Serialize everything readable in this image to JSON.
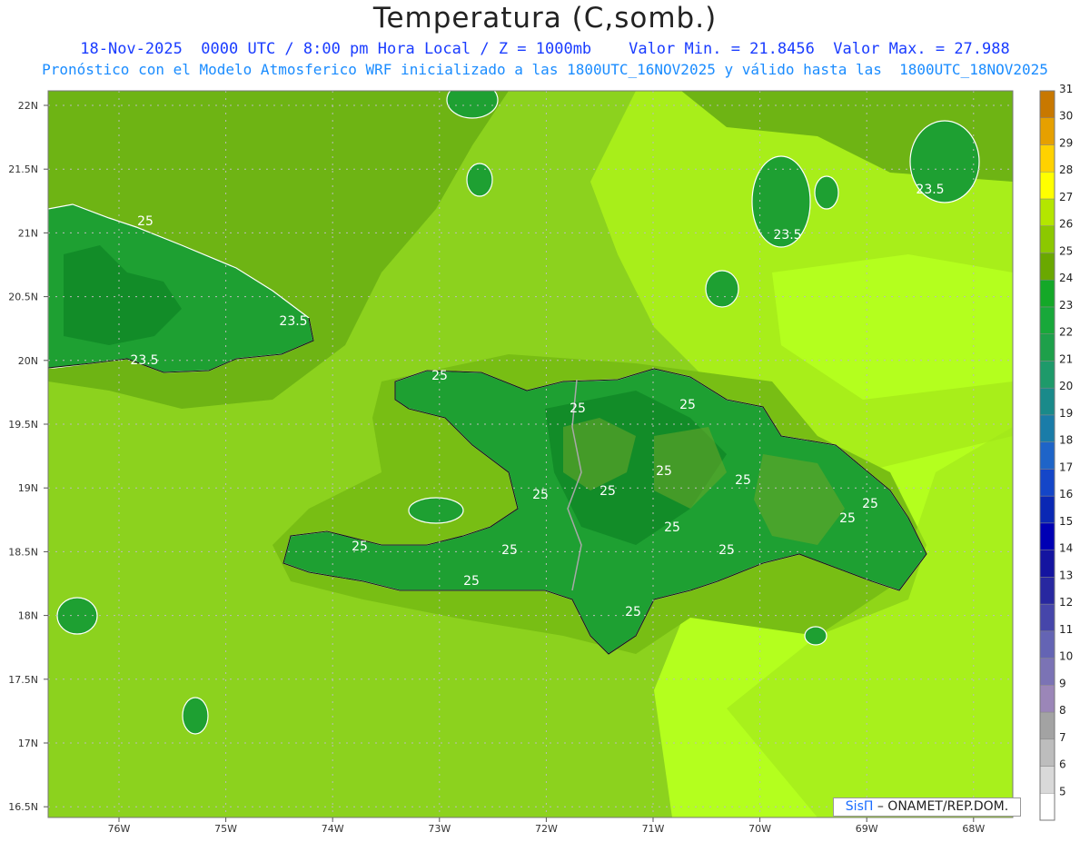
{
  "title": "Temperatura (C,somb.)",
  "subtitle_line1": "18-Nov-2025  0000 UTC / 8:00 pm Hora Local / Z = 1000mb    Valor Min. = 21.8456  Valor Max. = 27.988",
  "subtitle_line2": "Pronóstico con el Modelo Atmosferico WRF inicializado a las 1800UTC_16NOV2025 y válido hasta las  1800UTC_18NOV2025",
  "credit": {
    "brand": "SisΠ",
    "rest": "– ONAMET/REP.DOM."
  },
  "lat_labels": [
    "22N",
    "21.5N",
    "21N",
    "20.5N",
    "20N",
    "19.5N",
    "19N",
    "18.5N",
    "18N",
    "17.5N",
    "17N",
    "16.5N"
  ],
  "lon_labels": [
    "76W",
    "75W",
    "74W",
    "73W",
    "72W",
    "71W",
    "70W",
    "69W",
    "68W"
  ],
  "contour_labels": [
    "25",
    "25",
    "25",
    "25",
    "25",
    "25",
    "25",
    "25",
    "25",
    "25",
    "25",
    "25",
    "25",
    "25",
    "25",
    "25",
    "23.5",
    "23.5",
    "23.5",
    "23.5"
  ],
  "colorbar": {
    "levels": [
      "5",
      "6",
      "7",
      "8",
      "9",
      "10",
      "11",
      "12",
      "13",
      "14",
      "15",
      "16",
      "17",
      "18",
      "19",
      "20",
      "21",
      "22",
      "23",
      "24",
      "25",
      "26",
      "27",
      "28",
      "29",
      "30",
      "31"
    ],
    "colors": [
      "#ffffff",
      "#d9d9d9",
      "#bdbdbd",
      "#a3a3a3",
      "#9b86b8",
      "#7b73b5",
      "#6464b4",
      "#4646aa",
      "#2828a0",
      "#1414a0",
      "#0000b4",
      "#0a28b4",
      "#1446c8",
      "#1e64c8",
      "#1a7ca8",
      "#1a8a8a",
      "#1e9a6a",
      "#1ea04a",
      "#18a83a",
      "#14a828",
      "#6aa800",
      "#8cc800",
      "#b4e600",
      "#ffff00",
      "#ffd200",
      "#e6a000",
      "#c87800"
    ],
    "palette": {
      "sea_light": "#b4ff1e",
      "sea_mid": "#8cd21e",
      "sea_dark": "#6eb414",
      "land": "#1ea032",
      "land_dark": "#128c28"
    }
  }
}
